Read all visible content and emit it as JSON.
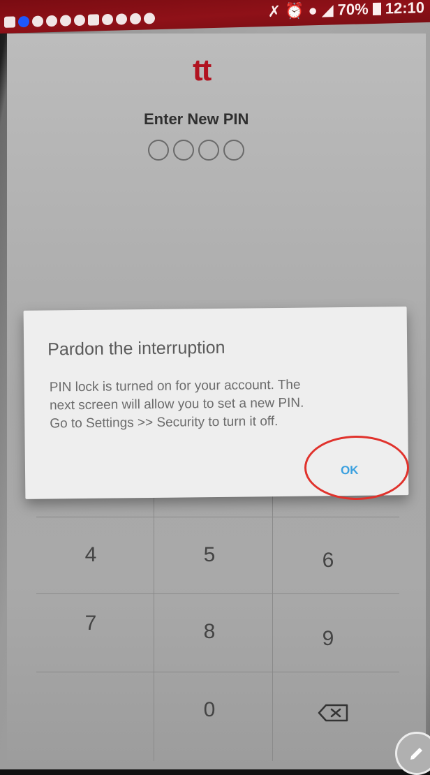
{
  "app": {
    "logo": "tt"
  },
  "status_bar": {
    "battery": "70%",
    "time": "12:10"
  },
  "pin_screen": {
    "title": "Enter New PIN",
    "dot_count": 4
  },
  "dialog": {
    "title": "Pardon the interruption",
    "body_line1": "PIN lock is turned on for your account. The",
    "body_line2": "next screen will allow you to set a new PIN.",
    "body_line3": "Go to Settings >> Security to turn it off.",
    "ok_label": "OK"
  },
  "keypad": {
    "keys": [
      "4",
      "5",
      "6",
      "7",
      "8",
      "9",
      "0"
    ],
    "backspace_icon": "backspace-icon"
  },
  "annotation": {
    "highlight_color": "#e0322c"
  },
  "colors": {
    "brand": "#b11320",
    "accent": "#3aa0df"
  }
}
